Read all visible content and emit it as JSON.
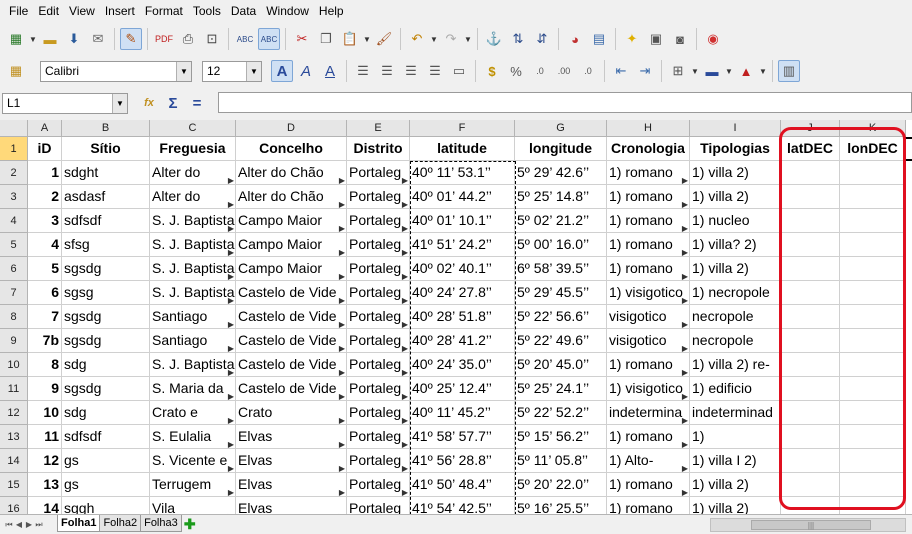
{
  "menu": [
    "File",
    "Edit",
    "View",
    "Insert",
    "Format",
    "Tools",
    "Data",
    "Window",
    "Help"
  ],
  "font": {
    "name": "Calibri",
    "size": "12"
  },
  "namebox": "L1",
  "columns": [
    "A",
    "B",
    "C",
    "D",
    "E",
    "F",
    "G",
    "H",
    "I",
    "J",
    "K"
  ],
  "header_row": {
    "row": "1",
    "A": "iD",
    "B": "Sítio",
    "C": "Freguesia",
    "D": "Concelho",
    "E": "Distrito",
    "F": "latitude",
    "G": "longitude",
    "H": "Cronologia",
    "I": "Tipologias",
    "J": "latDEC",
    "K": "lonDEC"
  },
  "rows": [
    {
      "row": "2",
      "A": "1",
      "B": "sdght",
      "C": "Alter do",
      "D": "Alter do Chão",
      "E": "Portaleg",
      "F": "40º 11’ 53.1’’",
      "G": "5º 29’ 42.6’’",
      "H": "1) romano",
      "I": "1) villa 2)"
    },
    {
      "row": "3",
      "A": "2",
      "B": "asdasf",
      "C": "Alter do",
      "D": "Alter do Chão",
      "E": "Portaleg",
      "F": "40º 01’ 44.2’’",
      "G": "5º 25’ 14.8’’",
      "H": "1) romano",
      "I": "1) villa 2)"
    },
    {
      "row": "4",
      "A": "3",
      "B": "sdfsdf",
      "C": "S. J. Baptista",
      "D": "Campo Maior",
      "E": "Portaleg",
      "F": "40º 01’ 10.1’’",
      "G": "5º 02’ 21.2’’",
      "H": "1) romano",
      "I": "1) nucleo"
    },
    {
      "row": "5",
      "A": "4",
      "B": "sfsg",
      "C": "S. J. Baptista",
      "D": "Campo Maior",
      "E": "Portaleg",
      "F": "41º 51’ 24.2’’",
      "G": "5º 00’ 16.0’’",
      "H": "1) romano",
      "I": "1) villa? 2)"
    },
    {
      "row": "6",
      "A": "5",
      "B": "sgsdg",
      "C": "S. J. Baptista",
      "D": "Campo Maior",
      "E": "Portaleg",
      "F": "40º 02’ 40.1’’",
      "G": "6º 58’ 39.5’’",
      "H": "1) romano",
      "I": "1) villa 2)"
    },
    {
      "row": "7",
      "A": "6",
      "B": "sgsg",
      "C": "S. J. Baptista",
      "D": "Castelo de Vide",
      "E": "Portaleg",
      "F": "40º 24’ 27.8’’",
      "G": "5º 29’ 45.5’’",
      "H": "1) visigotico",
      "I": "1) necropole"
    },
    {
      "row": "8",
      "A": "7",
      "B": "sgsdg",
      "C": "Santiago",
      "D": "Castelo de Vide",
      "E": "Portaleg",
      "F": "40º 28’ 51.8’’",
      "G": "5º 22’ 56.6’’",
      "H": "visigotico",
      "I": "necropole"
    },
    {
      "row": "9",
      "A": "7b",
      "B": "sgsdg",
      "C": "Santiago",
      "D": "Castelo de Vide",
      "E": "Portaleg",
      "F": "40º 28’ 41.2’’",
      "G": "5º 22’ 49.6’’",
      "H": "visigotico",
      "I": "necropole"
    },
    {
      "row": "10",
      "A": "8",
      "B": "sdg",
      "C": "S. J. Baptista",
      "D": "Castelo de Vide",
      "E": "Portaleg",
      "F": "40º 24’ 35.0’’",
      "G": "5º 20’ 45.0’’",
      "H": "1) romano",
      "I": "1) villa 2) re-"
    },
    {
      "row": "11",
      "A": "9",
      "B": "sgsdg",
      "C": "S. Maria da",
      "D": "Castelo de Vide",
      "E": "Portaleg",
      "F": "40º 25’ 12.4’’",
      "G": "5º 25’ 24.1’’",
      "H": "1) visigotico",
      "I": "1) edificio"
    },
    {
      "row": "12",
      "A": "10",
      "B": "sdg",
      "C": "Crato e",
      "D": "Crato",
      "E": "Portaleg",
      "F": "40º 11’ 45.2’’",
      "G": "5º 22’ 52.2’’",
      "H": "indetermina",
      "I": "indeterminad"
    },
    {
      "row": "13",
      "A": "11",
      "B": "sdfsdf",
      "C": "S. Eulalia",
      "D": "Elvas",
      "E": "Portaleg",
      "F": "41º 58’ 57.7’’",
      "G": "5º 15’ 56.2’’",
      "H": "1) romano",
      "I": "1)"
    },
    {
      "row": "14",
      "A": "12",
      "B": "gs",
      "C": "S. Vicente e",
      "D": "Elvas",
      "E": "Portaleg",
      "F": "41º 56’ 28.8’’",
      "G": "5º 11’ 05.8’’",
      "H": "1) Alto-",
      "I": "1) villa I 2)"
    },
    {
      "row": "15",
      "A": "13",
      "B": "gs",
      "C": "Terrugem",
      "D": "Elvas",
      "E": "Portaleg",
      "F": "41º 50’ 48.4’’",
      "G": "5º 20’ 22.0’’",
      "H": "1) romano",
      "I": "1) villa 2)"
    },
    {
      "row": "16",
      "A": "14",
      "B": "sggh",
      "C": "Vila",
      "D": "Elvas",
      "E": "Portaleg",
      "F": "41º 54’ 42.5’’",
      "G": "5º 16’ 25.5’’",
      "H": "1) romano",
      "I": "1) villa 2)"
    }
  ],
  "sheets": [
    "Folha1",
    "Folha2",
    "Folha3"
  ],
  "accent": "#e01020"
}
